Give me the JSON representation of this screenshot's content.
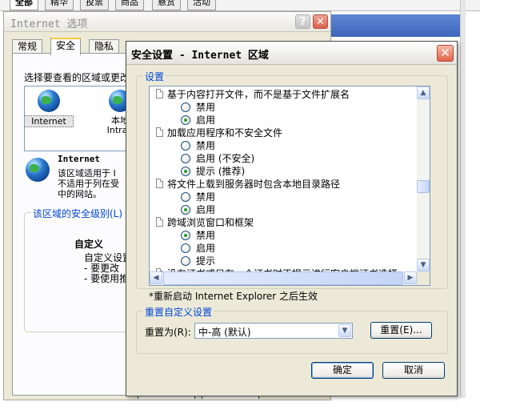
{
  "browser_tabs": [
    "全部",
    "精华",
    "投票",
    "商品",
    "悬赏",
    "活动"
  ],
  "options_dialog": {
    "title": "Internet 选项",
    "help_glyph": "?",
    "close_glyph": "✕",
    "tabs": [
      "常规",
      "安全",
      "隐私"
    ],
    "zone_prompt": "选择要查看的区域或更改",
    "zones": [
      {
        "label": "Internet",
        "icon": "globe-icon"
      },
      {
        "label": "本地 Intran",
        "icon": "local-intranet-icon"
      }
    ],
    "zone_info": {
      "title": "Internet",
      "desc_lines": [
        "该区域适用于 I",
        "不适用于列在受",
        "中的网站。"
      ]
    },
    "security_level": {
      "title": "该区域的安全级别(L)",
      "custom_title": "自定义",
      "custom_lines": [
        "自定义设置",
        "- 要更改",
        "- 要使用推"
      ]
    }
  },
  "security_dialog": {
    "title": "安全设置 - Internet 区域",
    "close_glyph": "✕",
    "settings_label": "设置",
    "tree_items": [
      {
        "kind": "category",
        "text": "基于内容打开文件，而不是基于文件扩展名"
      },
      {
        "kind": "option",
        "text": "禁用",
        "checked": false
      },
      {
        "kind": "option",
        "text": "启用",
        "checked": true
      },
      {
        "kind": "category",
        "text": "加载应用程序和不安全文件"
      },
      {
        "kind": "option",
        "text": "禁用",
        "checked": false
      },
      {
        "kind": "option",
        "text": "启用 (不安全)",
        "checked": false
      },
      {
        "kind": "option",
        "text": "提示 (推荐)",
        "checked": true
      },
      {
        "kind": "category",
        "text": "将文件上载到服务器时包含本地目录路径"
      },
      {
        "kind": "option",
        "text": "禁用",
        "checked": false
      },
      {
        "kind": "option",
        "text": "启用",
        "checked": true
      },
      {
        "kind": "category",
        "text": "跨域浏览窗口和框架"
      },
      {
        "kind": "option",
        "text": "禁用",
        "checked": true
      },
      {
        "kind": "option",
        "text": "启用",
        "checked": false
      },
      {
        "kind": "option",
        "text": "提示",
        "checked": false
      },
      {
        "kind": "category",
        "text": "没有证书或只有一个证书时不提示进行客户端证书选择"
      }
    ],
    "vertical_scroll_fraction": 0.55,
    "restart_note": "*重新启动 Internet Explorer 之后生效",
    "reset_group_title": "重置自定义设置",
    "reset_to_label": "重置为(R):",
    "reset_to_value": "中-高 (默认)",
    "reset_button": "重置(E)...",
    "ok_button": "确定",
    "cancel_button": "取消"
  },
  "colors": {
    "group_title": "#0046d5",
    "dialog_bg": "#ece9d8",
    "checked_radio": "#21a121"
  }
}
